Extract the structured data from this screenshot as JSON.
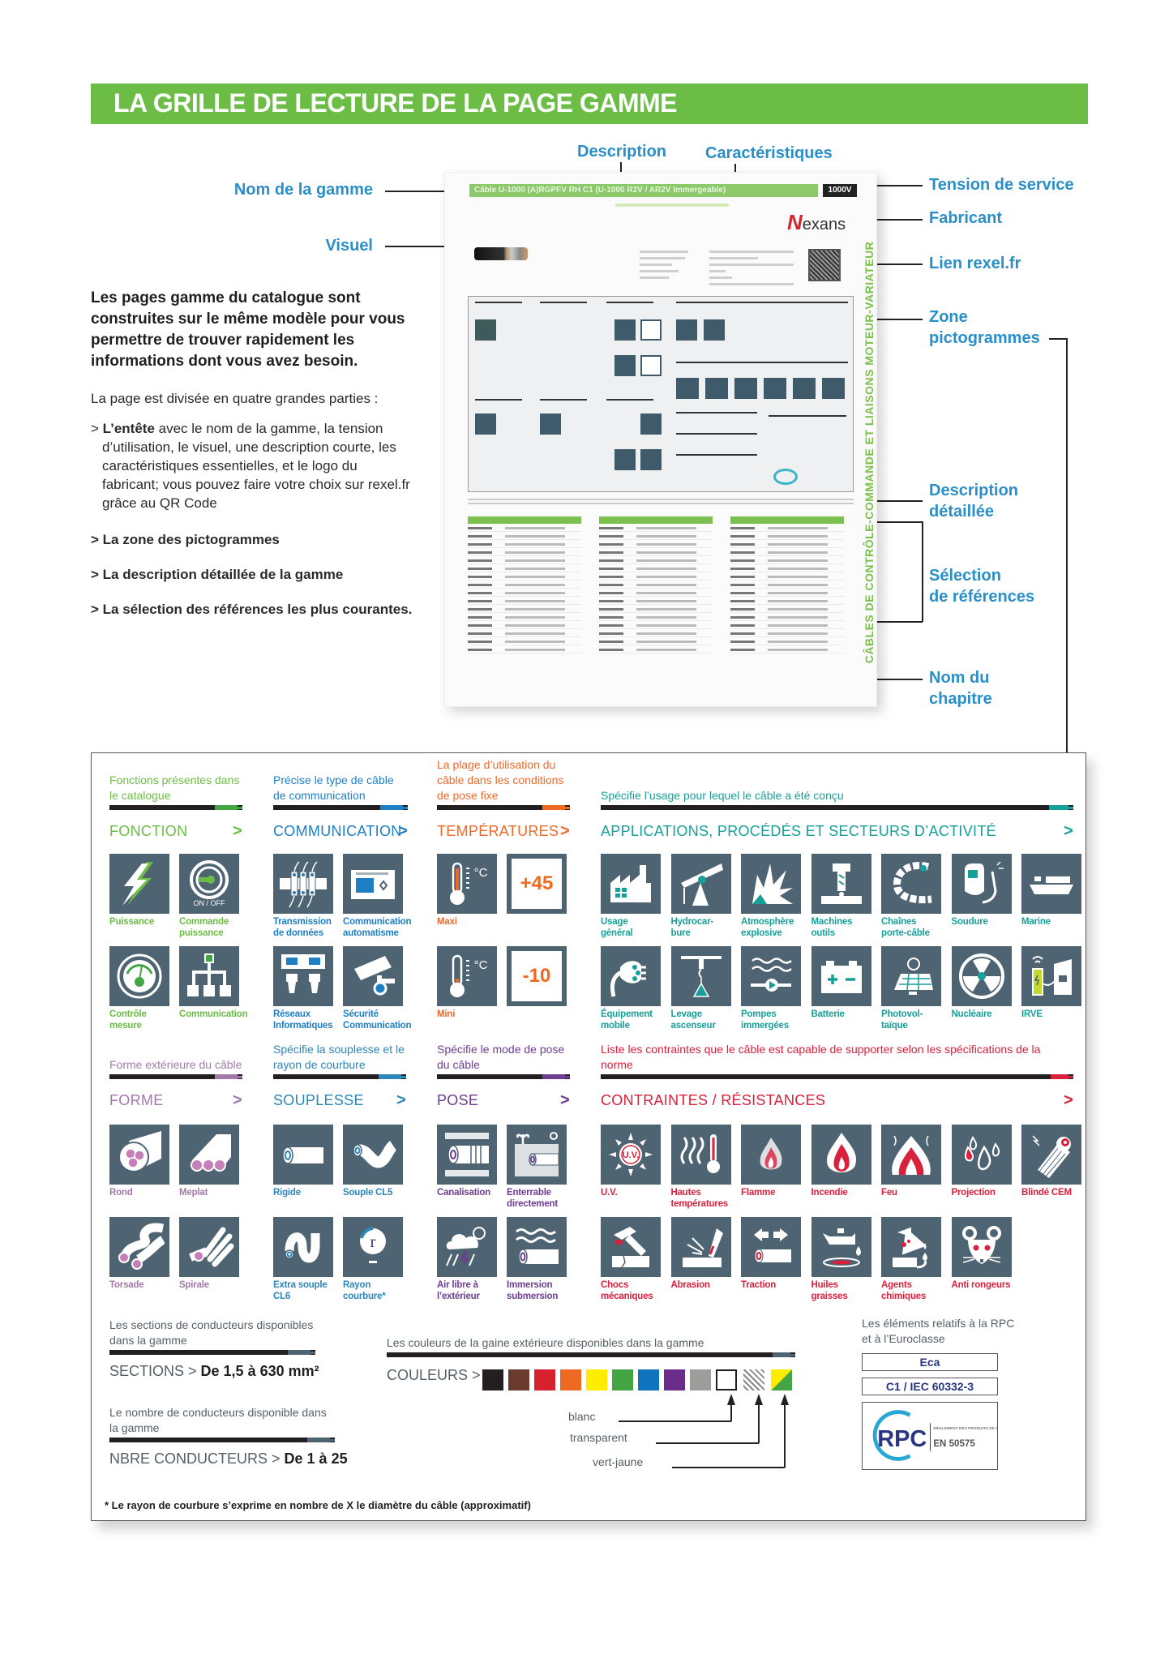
{
  "banner": {
    "title": "LA GRILLE DE LECTURE DE LA PAGE GAMME"
  },
  "callouts": {
    "description": "Description",
    "caracteristiques": "Caractéristiques",
    "nom_gamme": "Nom de la gamme",
    "visuel": "Visuel",
    "tension": "Tension de service",
    "fabricant": "Fabricant",
    "lien": "Lien rexel.fr",
    "zone_picto_1": "Zone",
    "zone_picto_2": "pictogrammes",
    "desc_det_1": "Description",
    "desc_det_2": "détaillée",
    "selection_1": "Sélection",
    "selection_2": "de références",
    "chapitre_1": "Nom du",
    "chapitre_2": "chapitre"
  },
  "intro": {
    "lead": "Les pages gamme du catalogue sont construites sur le même modèle pour vous permettre de trouver rapidement les informations dont vous avez besoin.",
    "sub": "La page est divisée en quatre grandes parties :",
    "items": [
      {
        "bold": "L’entête",
        "text": " avec le nom de la gamme, la tension d’utilisation, le visuel, une description courte, les caractéristiques essentielles, et le logo du fabricant; vous pouvez faire votre choix sur rexel.fr grâce au QR Code"
      },
      {
        "bold": "La zone des pictogrammes",
        "text": ""
      },
      {
        "bold": "La description détaillée de la gamme",
        "text": ""
      },
      {
        "bold": "La sélection des références les plus courantes.",
        "text": ""
      }
    ],
    "bullet": "> "
  },
  "thumbnail": {
    "header": "Câble U-1000 (A)RGPFV RH C1 (U-1000 R2V / AR2V Immergeable)",
    "voltage": "1000V",
    "brand_initial": "N",
    "brand_rest": "exans",
    "chapter": "CÂBLES DE CONTRÔLE-COMMANDE ET LIAISONS MOTEUR-VARIATEUR"
  },
  "sections": {
    "fonction": {
      "desc": "Fonctions présentes dans le catalogue",
      "title": "FONCTION",
      "chevron": ">",
      "color": "#6cbd45",
      "tiles": [
        "Puissance",
        "Commande puissance",
        "Contrôle mesure",
        "Communication"
      ],
      "onoff": "ON / OFF"
    },
    "communication": {
      "desc": "Précise le type de câble de communication",
      "title": "COMMUNICATION",
      "chevron": ">",
      "color": "#1e7fc4",
      "tiles": [
        "Transmission de données",
        "Communication automatisme",
        "Réseaux Informatiques",
        "Sécurité Communication"
      ]
    },
    "temperatures": {
      "desc": "La plage d’utilisation du câble dans les conditions de pose fixe",
      "title": "TEMPÉRATURES",
      "chevron": ">",
      "color": "#ee6a2a",
      "tiles": [
        "Maxi",
        "Mini"
      ],
      "max_value": "+45",
      "min_value": "-10",
      "unit": "°C"
    },
    "applications": {
      "desc": "Spécifie l’usage pour lequel le câble a été conçu",
      "title": "APPLICATIONS, PROCÉDÉS ET SECTEURS D’ACTIVITÉ",
      "chevron": ">",
      "color": "#17a09a",
      "tiles": [
        "Usage général",
        "Hydrocar-bure",
        "Atmosphère explosive",
        "Machines outils",
        "Chaînes porte-câble",
        "Soudure",
        "Marine",
        "Équipement mobile",
        "Levage ascenseur",
        "Pompes immergées",
        "Batterie",
        "Photovol-taïque",
        "Nucléaire",
        "IRVE"
      ]
    },
    "forme": {
      "desc": "Forme extérieure du câble",
      "title": "FORME",
      "chevron": ">",
      "color": "#a27aa8",
      "tiles": [
        "Rond",
        "Meplat",
        "Torsade",
        "Spirale"
      ]
    },
    "souplesse": {
      "desc": "Spécifie la souplesse et le rayon de courbure",
      "title": "SOUPLESSE",
      "chevron": ">",
      "color": "#2c86b8",
      "tiles": [
        "Rigide",
        "Souple CL5",
        "Extra souple CL6",
        "Rayon courbure*"
      ],
      "radius_symbol": "r"
    },
    "pose": {
      "desc": "Spécifie le mode de pose du câble",
      "title": "POSE",
      "chevron": ">",
      "color": "#6d3d91",
      "tiles": [
        "Canalisation",
        "Enterrable directement",
        "Air libre à l’extérieur",
        "Immersion submersion"
      ]
    },
    "contraintes": {
      "desc": "Liste les contraintes que le câble est capable de supporter selon les spécifications de la norme",
      "title": "CONTRAINTES / RÉSISTANCES",
      "chevron": ">",
      "color": "#d9203c",
      "tiles": [
        "U.V.",
        "Hautes températures",
        "Flamme",
        "Incendie",
        "Feu",
        "Projection",
        "Blindé CEM",
        "Chocs mécaniques",
        "Abrasion",
        "Traction",
        "Huiles graisses",
        "Agents chimiques",
        "Anti rongeurs"
      ],
      "uv_text": "U.V."
    }
  },
  "info": {
    "sections": {
      "desc": "Les sections de conducteurs disponibles dans la gamme",
      "label": "SECTIONS > ",
      "value": "De 1,5 à 630 mm²"
    },
    "conducteurs": {
      "desc": "Le nombre de conducteurs disponible dans la gamme",
      "label": "NBRE CONDUCTEURS > ",
      "value": "De 1 à 25"
    },
    "couleurs": {
      "desc": "Les couleurs de la gaine extérieure disponibles dans la gamme",
      "label": "COULEURS >",
      "swatches": [
        "#231f20",
        "#6b3a2e",
        "#d7212d",
        "#ee6a22",
        "#ffed00",
        "#43a544",
        "#0f74bd",
        "#6b2c8c",
        "#9d9d9c"
      ],
      "special": [
        "blanc",
        "transparent",
        "vert-jaune"
      ]
    },
    "rpc": {
      "desc": "Les éléments relatifs à la RPC et à l’Euroclasse",
      "euroclasse": "Eca",
      "norme": "C1 / IEC 60332-3",
      "logo": "RPC",
      "logo_caption": "RÈGLEMENT DES PRODUITS DE CONSTRUCTION",
      "logo_norme": "EN 50575"
    }
  },
  "footnote": "* Le rayon de courbure s’exprime en nombre de X le diamètre du câble (approximatif)"
}
